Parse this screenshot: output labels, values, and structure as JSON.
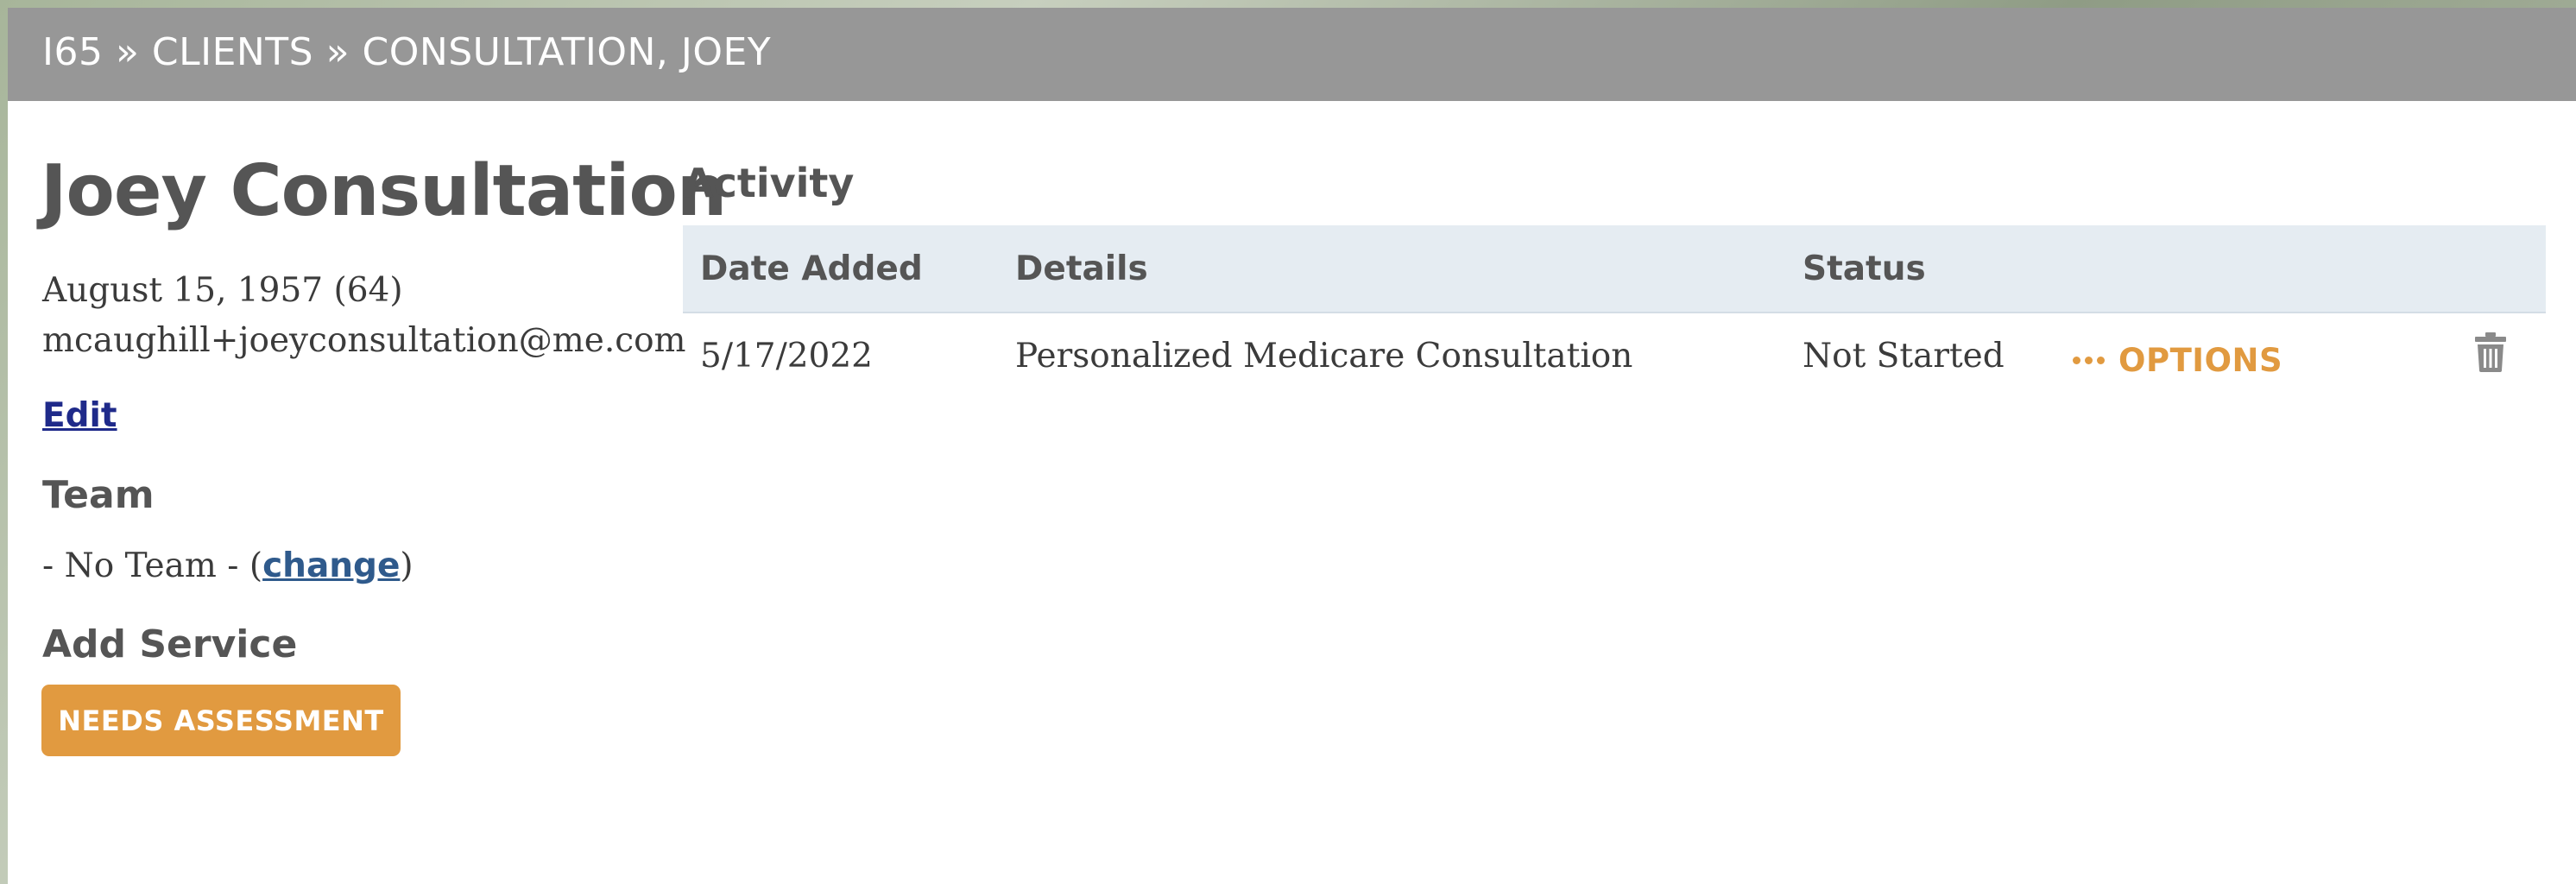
{
  "breadcrumb": "I65 » CLIENTS » CONSULTATION, JOEY",
  "client": {
    "name": "Joey Consultation",
    "dob": "August 15, 1957 (64)",
    "email": "mcaughill+joeyconsultation@me.com",
    "edit_label": "Edit"
  },
  "team": {
    "heading": "Team",
    "prefix": "- No Team - (",
    "change_label": "change",
    "suffix": ")"
  },
  "add_service": {
    "heading": "Add Service",
    "button_label": "NEEDS ASSESSMENT"
  },
  "activity": {
    "heading": "Activity",
    "columns": [
      "Date Added",
      "Details",
      "Status"
    ],
    "rows": [
      {
        "date_added": "5/17/2022",
        "details": "Personalized Medicare Consultation",
        "status": "Not Started",
        "options_label": "OPTIONS",
        "options_icon": "ellipsis-icon",
        "delete_icon": "trash-icon"
      }
    ]
  },
  "colors": {
    "header_bg": "#979797",
    "accent": "#e19a40",
    "table_header_bg": "#e5ecf2",
    "heading_text": "#555555",
    "link_blue": "#2f5a8c"
  }
}
